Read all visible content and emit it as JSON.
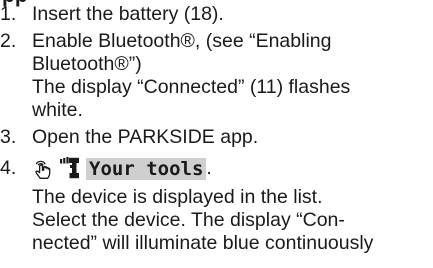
{
  "heading_fragment": "pp",
  "steps": [
    {
      "number": "1.",
      "lines": [
        "Insert the battery (18)."
      ]
    },
    {
      "number": "2.",
      "lines": [
        "Enable Bluetooth®, (see “Enabling",
        "Bluetooth®”)",
        "The display “Connected” (11) flashes",
        "white."
      ]
    },
    {
      "number": "3.",
      "lines": [
        "Open the PARKSIDE app."
      ]
    },
    {
      "number": "4.",
      "icons": [
        "tap-hand-icon",
        "tool-device-icon"
      ],
      "nav_label": "Your tools",
      "nav_suffix": ".",
      "lines": [
        "The device is displayed in the list.",
        "Select the device. The display “Con-",
        "nected” will illuminate blue continuously"
      ]
    }
  ]
}
